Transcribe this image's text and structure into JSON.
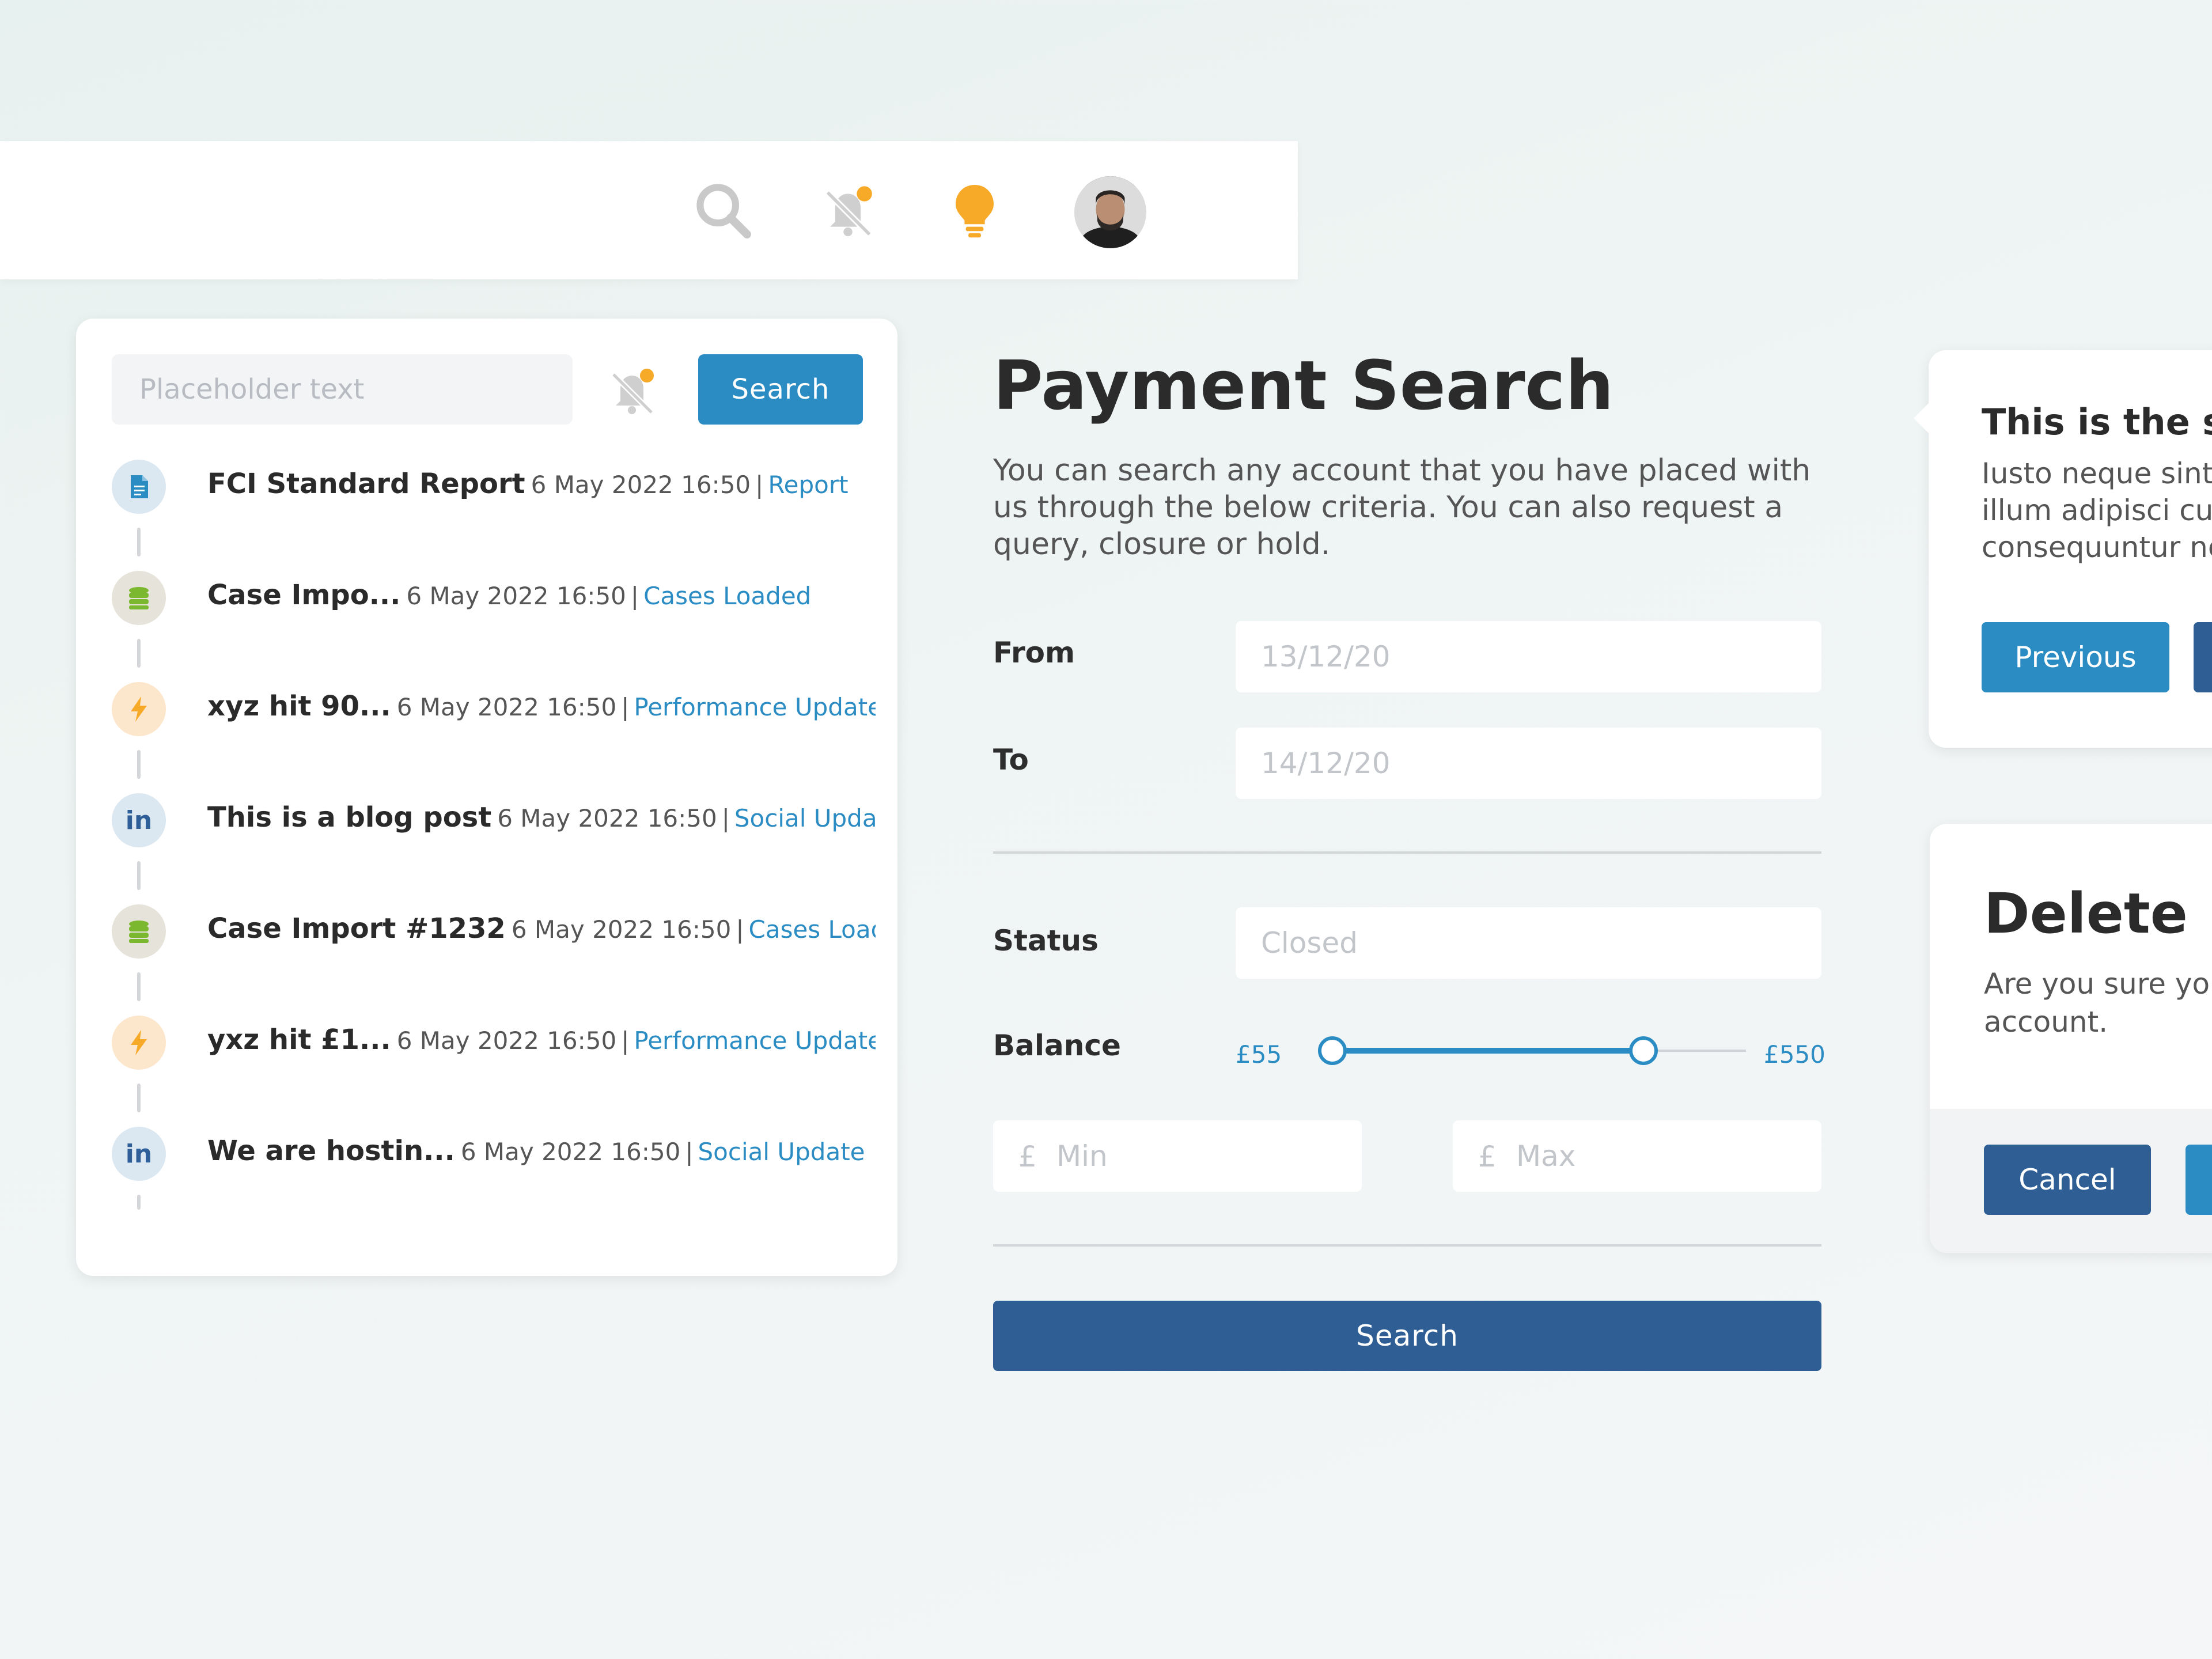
{
  "topbar": {
    "icons": [
      "search-icon",
      "bell-muted-icon",
      "lightbulb-icon"
    ],
    "avatar": "user-avatar"
  },
  "activity": {
    "search_placeholder": "Placeholder text",
    "search_button": "Search",
    "items": [
      {
        "title": "FCI Standard Report",
        "date": "6 May 2022 16:50",
        "sep": "|",
        "link": "Report",
        "icon": "document-icon",
        "kind": "doc"
      },
      {
        "title": "Case Impo...",
        "date": "6 May 2022 16:50",
        "sep": "|",
        "link": "Cases Loaded",
        "icon": "database-icon",
        "kind": "db"
      },
      {
        "title": "xyz hit 90...",
        "date": "6 May 2022 16:50",
        "sep": "|",
        "link": "Performance Update",
        "icon": "lightning-icon",
        "kind": "bolt"
      },
      {
        "title": "This is a blog post",
        "date": "6 May 2022 16:50",
        "sep": "|",
        "link": "Social Update",
        "icon": "linkedin-icon",
        "kind": "in"
      },
      {
        "title": "Case Import #1232",
        "date": "6 May 2022 16:50",
        "sep": "|",
        "link": "Cases Loaded",
        "icon": "database-icon",
        "kind": "db"
      },
      {
        "title": "yxz hit £1...",
        "date": "6 May 2022 16:50",
        "sep": "|",
        "link": "Performance Update",
        "icon": "lightning-icon",
        "kind": "bolt"
      },
      {
        "title": "We are hostin...",
        "date": "6 May 2022 16:50",
        "sep": "|",
        "link": "Social Update",
        "icon": "linkedin-icon",
        "kind": "in"
      }
    ]
  },
  "payment_search": {
    "title": "Payment Search",
    "description": "You can search any account that you have placed with us through the below criteria. You can also request a query, closure or hold.",
    "from_label": "From",
    "from_placeholder": "13/12/20",
    "to_label": "To",
    "to_placeholder": "14/12/20",
    "status_label": "Status",
    "status_placeholder": "Closed",
    "balance_label": "Balance",
    "balance_min": "£55",
    "balance_max": "£550",
    "currency_symbol": "£",
    "min_placeholder": "Min",
    "max_placeholder": "Max",
    "search_button": "Search"
  },
  "popover": {
    "title": "This is the sul",
    "body": "Iusto neque sint.\nillum adipisci cul\nconsequuntur ne",
    "previous_button": "Previous"
  },
  "modal": {
    "title": "Delete Us",
    "body": "Are you sure you\naccount.",
    "cancel_button": "Cancel"
  },
  "colors": {
    "primary": "#2b8cc4",
    "dark_primary": "#2e5e94",
    "accent_orange": "#f7a928"
  }
}
